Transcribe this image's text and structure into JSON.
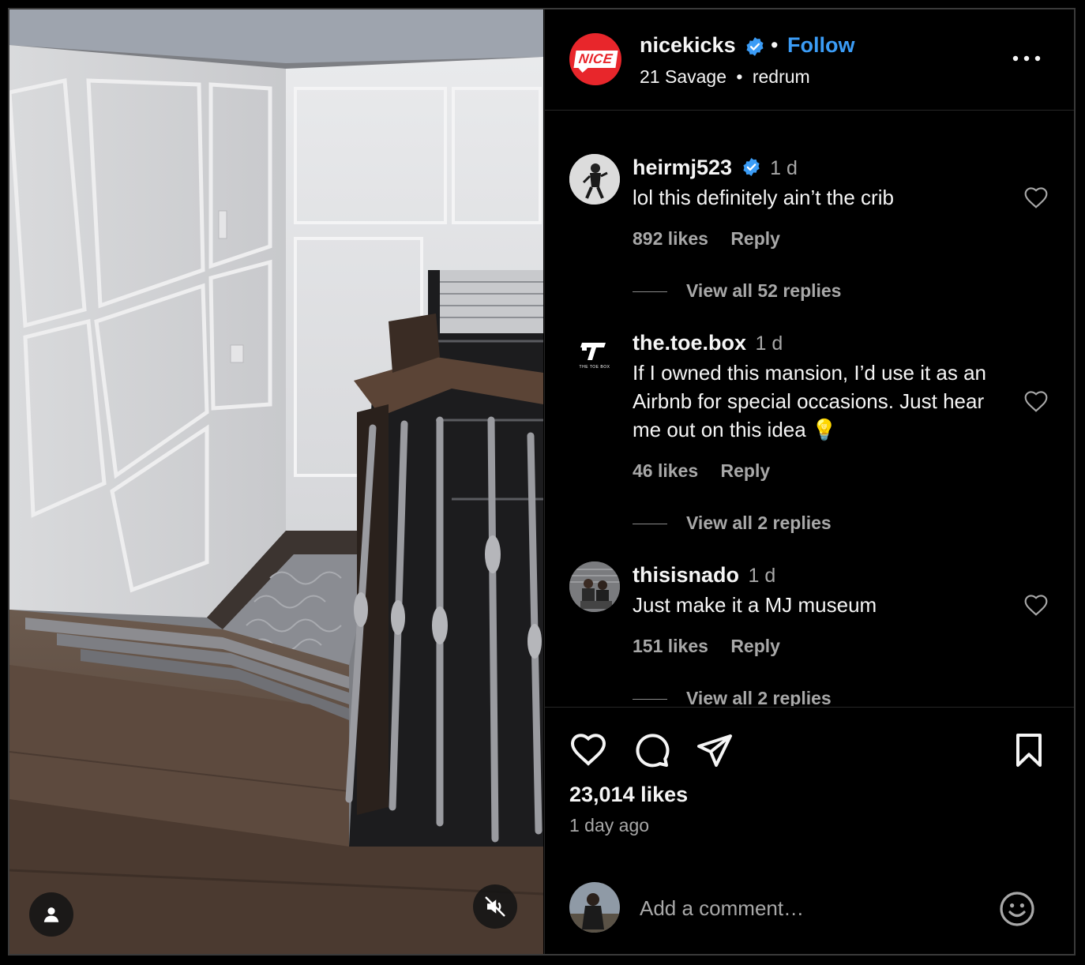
{
  "post": {
    "username": "nicekicks",
    "avatar_text": "NICE",
    "separator": "•",
    "follow_label": "Follow",
    "audio_artist": "21 Savage",
    "audio_separator": "•",
    "audio_track": "redrum",
    "likes": "23,014 likes",
    "time_ago": "1 day ago"
  },
  "comments": [
    {
      "username": "heirmj523",
      "verified": true,
      "time": "1 d",
      "text": "lol this definitely ain’t the crib",
      "likes": "892 likes",
      "reply_label": "Reply",
      "view_replies": "View all 52 replies"
    },
    {
      "username": "the.toe.box",
      "verified": false,
      "time": "1 d",
      "avatar_caption": "THE TOE BOX",
      "text": "If I owned this mansion, I’d use it as an Airbnb for special occasions. Just hear me out on this idea 💡",
      "likes": "46 likes",
      "reply_label": "Reply",
      "view_replies": "View all 2 replies"
    },
    {
      "username": "thisisnado",
      "verified": false,
      "time": "1 d",
      "text": "Just make it a MJ museum",
      "likes": "151 likes",
      "reply_label": "Reply",
      "view_replies": "View all 2 replies"
    }
  ],
  "composer": {
    "placeholder": "Add a comment…"
  },
  "icons": {
    "more": "more-options-icon",
    "verified": "verified-badge-icon",
    "like": "heart-icon",
    "comment": "comment-bubble-icon",
    "share": "paper-plane-icon",
    "save": "bookmark-icon",
    "emoji": "emoji-icon",
    "user_tag": "user-tag-icon",
    "mute": "muted-speaker-icon"
  },
  "colors": {
    "accent_blue": "#3b9cf6",
    "brand_red": "#e8262b",
    "muted_text": "#a8a8a8"
  }
}
